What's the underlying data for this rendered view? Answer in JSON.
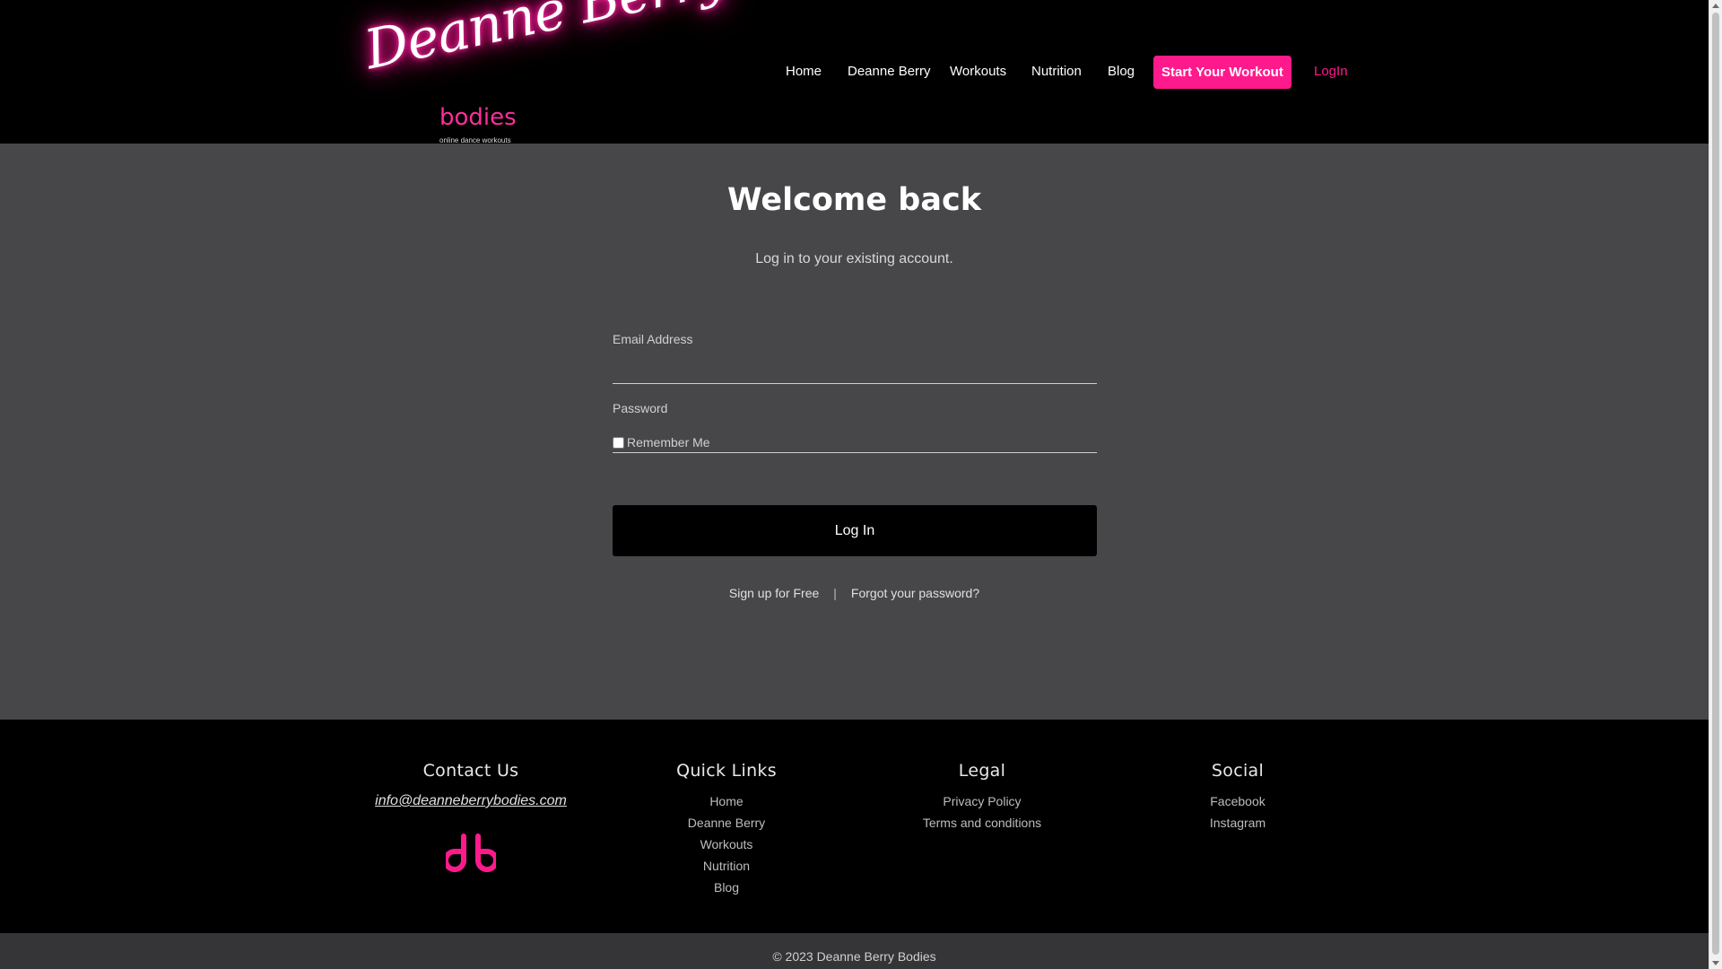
{
  "brand": {
    "script_name": "Deanne Berry",
    "sub_name": "bodies",
    "tagline": "online dance workouts",
    "accent_color": "#ff1a8c"
  },
  "nav": {
    "items": [
      {
        "label": "Home"
      },
      {
        "label": "Deanne Berry"
      },
      {
        "label": "Workouts"
      },
      {
        "label": "Nutrition"
      },
      {
        "label": "Blog"
      }
    ],
    "cta_label": "Start Your Workout",
    "login_label": "LogIn"
  },
  "login": {
    "title": "Welcome back",
    "subtitle": "Log in to your existing account.",
    "email_label": "Email Address",
    "email_value": "",
    "password_label": "Password",
    "password_value": "",
    "remember_label": "Remember Me",
    "remember_checked": false,
    "submit_label": "Log In",
    "signup_label": "Sign up for Free",
    "separator": "|",
    "forgot_label": "Forgot your password?"
  },
  "footer": {
    "contact": {
      "heading": "Contact Us",
      "email": "info@deanneberrybodies.com",
      "mark_icon": "db-monogram-icon"
    },
    "quick_links": {
      "heading": "Quick Links",
      "items": [
        "Home",
        "Deanne Berry",
        "Workouts",
        "Nutrition",
        "Blog"
      ]
    },
    "legal": {
      "heading": "Legal",
      "items": [
        "Privacy Policy",
        "Terms and conditions"
      ]
    },
    "social": {
      "heading": "Social",
      "items": [
        "Facebook",
        "Instagram"
      ]
    },
    "copyright": "© 2023 Deanne Berry Bodies"
  }
}
